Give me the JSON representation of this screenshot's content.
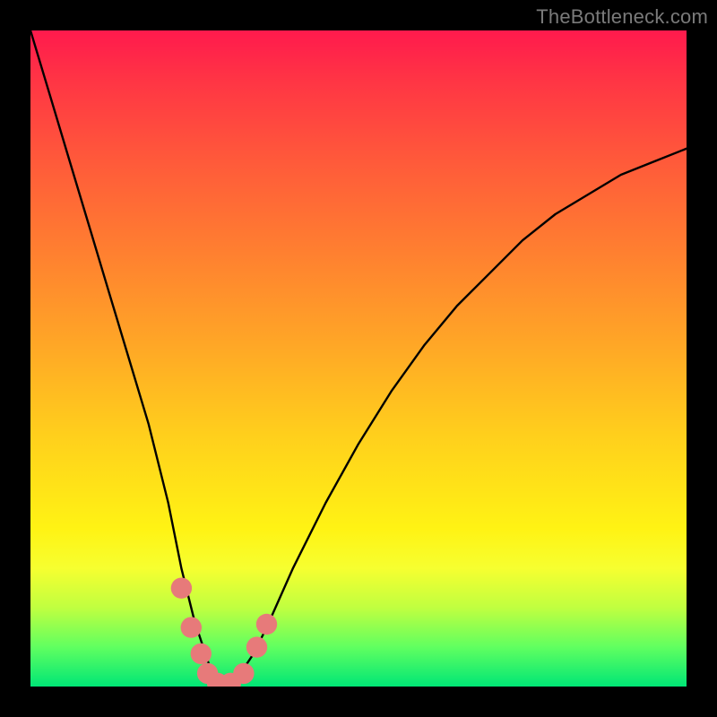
{
  "watermark": {
    "text": "TheBottleneck.com"
  },
  "chart_data": {
    "type": "line",
    "title": "",
    "xlabel": "",
    "ylabel": "",
    "xlim": [
      0,
      100
    ],
    "ylim": [
      0,
      100
    ],
    "series": [
      {
        "name": "bottleneck-curve",
        "x": [
          0,
          3,
          6,
          9,
          12,
          15,
          18,
          21,
          23,
          25,
          27,
          28,
          29,
          30,
          32,
          34,
          36,
          40,
          45,
          50,
          55,
          60,
          65,
          70,
          75,
          80,
          85,
          90,
          95,
          100
        ],
        "values": [
          100,
          90,
          80,
          70,
          60,
          50,
          40,
          28,
          18,
          10,
          4,
          1,
          0,
          0,
          2,
          5,
          9,
          18,
          28,
          37,
          45,
          52,
          58,
          63,
          68,
          72,
          75,
          78,
          80,
          82
        ]
      }
    ],
    "markers": [
      {
        "name": "point",
        "x": 23.0,
        "y": 15.0,
        "r": 1.6,
        "color": "#e77a7a"
      },
      {
        "name": "point",
        "x": 24.5,
        "y": 9.0,
        "r": 1.6,
        "color": "#e77a7a"
      },
      {
        "name": "point",
        "x": 26.0,
        "y": 5.0,
        "r": 1.6,
        "color": "#e77a7a"
      },
      {
        "name": "point",
        "x": 27.0,
        "y": 2.0,
        "r": 1.6,
        "color": "#e77a7a"
      },
      {
        "name": "point",
        "x": 28.5,
        "y": 0.5,
        "r": 1.6,
        "color": "#e77a7a"
      },
      {
        "name": "point",
        "x": 30.5,
        "y": 0.5,
        "r": 1.6,
        "color": "#e77a7a"
      },
      {
        "name": "point",
        "x": 32.5,
        "y": 2.0,
        "r": 1.6,
        "color": "#e77a7a"
      },
      {
        "name": "point",
        "x": 34.5,
        "y": 6.0,
        "r": 1.6,
        "color": "#e77a7a"
      },
      {
        "name": "point",
        "x": 36.0,
        "y": 9.5,
        "r": 1.6,
        "color": "#e77a7a"
      }
    ]
  }
}
